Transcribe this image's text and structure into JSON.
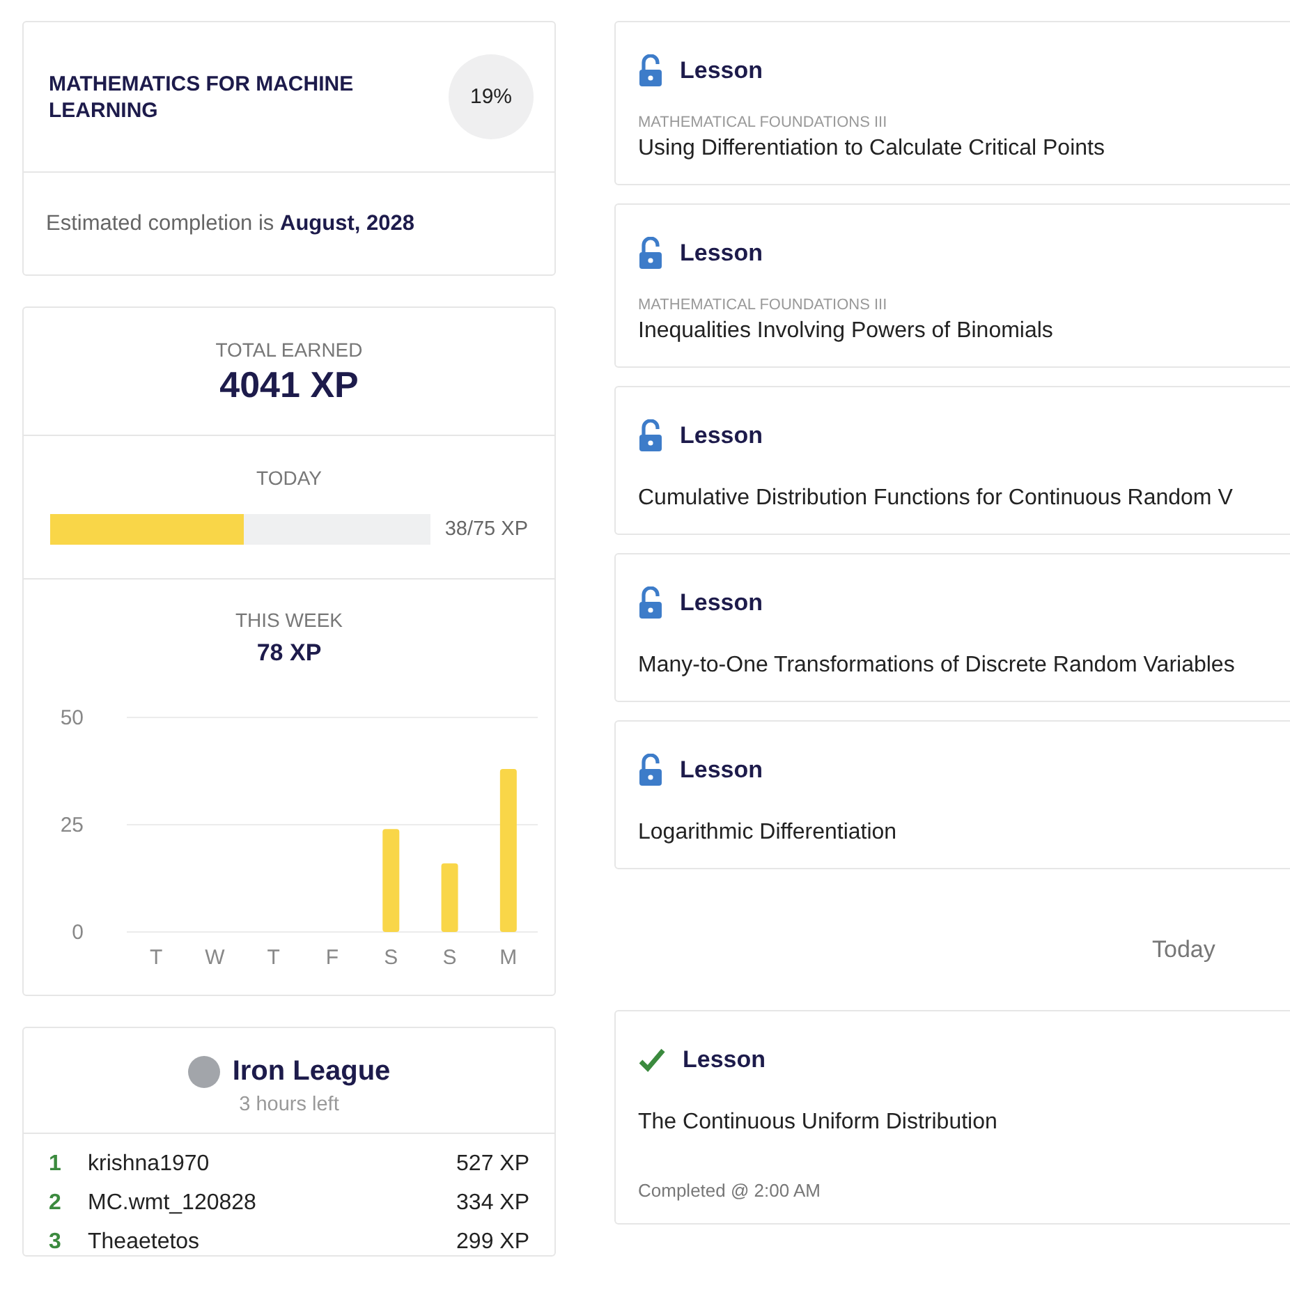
{
  "course": {
    "title": "MATHEMATICS FOR MACHINE LEARNING",
    "progress": "19%",
    "completion_label": "Estimated completion is",
    "completion_date": "August, 2028"
  },
  "stats": {
    "total_label": "TOTAL EARNED",
    "total_value": "4041 XP",
    "today_label": "TODAY",
    "today_bar": {
      "level": 0.507
    },
    "today_reading": "38/75 XP",
    "week_label": "THIS WEEK",
    "week_value": "78 XP",
    "chart_data": {
      "type": "bar",
      "categories": [
        "T",
        "W",
        "T",
        "F",
        "S",
        "S",
        "M"
      ],
      "series": [
        {
          "color": "#f9d648",
          "values": [
            0,
            0,
            0,
            0,
            24,
            16,
            38
          ]
        }
      ],
      "ylim": [
        0,
        50
      ],
      "yticks": [
        0,
        25,
        50
      ]
    }
  },
  "league": {
    "name": "Iron League",
    "time_left": "3 hours left",
    "rows": [
      {
        "rank": "1",
        "name": "krishna1970",
        "xp": "527 XP"
      },
      {
        "rank": "2",
        "name": "MC.wmt_120828",
        "xp": "334 XP"
      },
      {
        "rank": "3",
        "name": "Theaetetos",
        "xp": "299 XP"
      }
    ]
  },
  "lessons": [
    {
      "kind": "unlocked",
      "type": "Lesson",
      "course": "MATHEMATICAL FOUNDATIONS III",
      "title": "Using Differentiation to Calculate Critical Points"
    },
    {
      "kind": "unlocked",
      "type": "Lesson",
      "course": "MATHEMATICAL FOUNDATIONS III",
      "title": "Inequalities Involving Powers of Binomials"
    },
    {
      "kind": "unlocked",
      "type": "Lesson",
      "title": "Cumulative Distribution Functions for Continuous Random V"
    },
    {
      "kind": "unlocked",
      "type": "Lesson",
      "title": "Many-to-One Transformations of Discrete Random Variables"
    },
    {
      "kind": "unlocked",
      "type": "Lesson",
      "title": "Logarithmic Differentiation"
    }
  ],
  "history_label": "Today",
  "history": [
    {
      "kind": "completed",
      "type": "Lesson",
      "title": "The Continuous Uniform Distribution",
      "completed_at": "Completed @ 2:00 AM"
    }
  ]
}
